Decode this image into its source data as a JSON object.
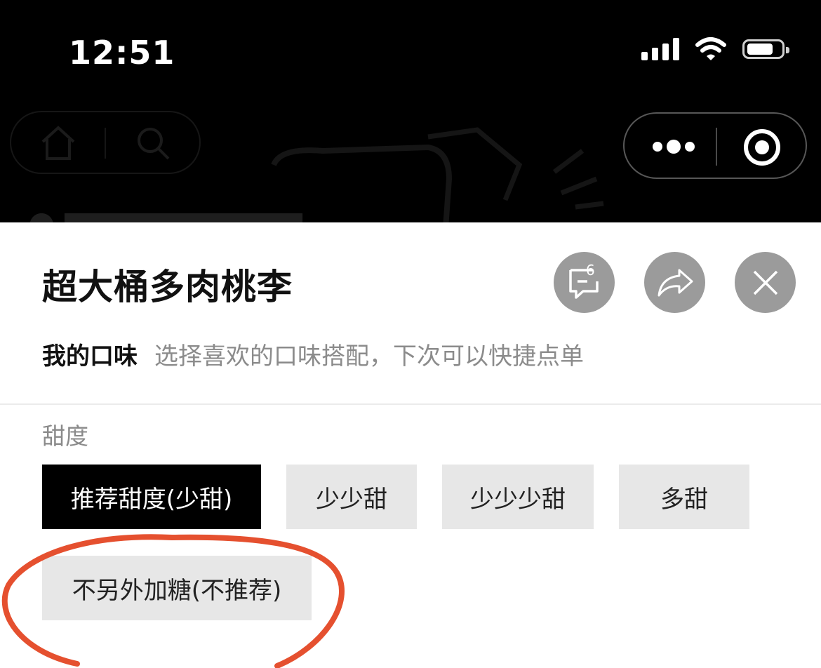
{
  "status_bar": {
    "time": "12:51"
  },
  "sheet": {
    "title": "超大桶多肉桃李",
    "comment_badge": "6",
    "taste_label": "我的口味",
    "taste_hint": "选择喜欢的口味搭配，下次可以快捷点单",
    "sweetness": {
      "title": "甜度",
      "options": [
        "推荐甜度(少甜)",
        "少少甜",
        "少少少甜",
        "多甜",
        "不另外加糖(不推荐)"
      ],
      "selected_index": 0
    }
  },
  "colors": {
    "annotation": "#e5502f",
    "selected_bg": "#000000",
    "option_bg": "#e7e7e7",
    "circle_button": "#9b9b9b"
  }
}
